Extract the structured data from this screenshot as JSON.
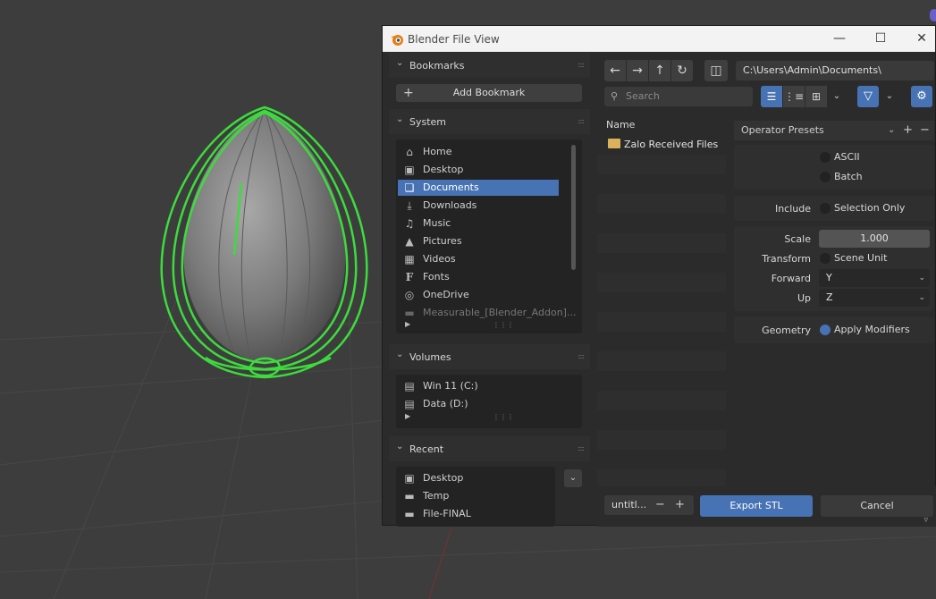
{
  "window": {
    "title": "Blender File View"
  },
  "sidebar": {
    "bookmarks": {
      "label": "Bookmarks",
      "add_label": "Add Bookmark"
    },
    "system": {
      "label": "System",
      "items": [
        {
          "label": "Home",
          "icon": "home-icon"
        },
        {
          "label": "Desktop",
          "icon": "desktop-icon"
        },
        {
          "label": "Documents",
          "icon": "documents-icon",
          "selected": true
        },
        {
          "label": "Downloads",
          "icon": "download-icon"
        },
        {
          "label": "Music",
          "icon": "music-icon"
        },
        {
          "label": "Pictures",
          "icon": "picture-icon"
        },
        {
          "label": "Videos",
          "icon": "video-icon"
        },
        {
          "label": "Fonts",
          "icon": "font-icon"
        },
        {
          "label": "OneDrive",
          "icon": "globe-icon"
        },
        {
          "label": "Measurable_[Blender_Addon]...",
          "icon": "folder-icon"
        }
      ]
    },
    "volumes": {
      "label": "Volumes",
      "items": [
        {
          "label": "Win 11 (C:)",
          "icon": "drive-icon"
        },
        {
          "label": "Data (D:)",
          "icon": "drive-icon"
        }
      ]
    },
    "recent": {
      "label": "Recent",
      "items": [
        {
          "label": "Desktop",
          "icon": "desktop-icon"
        },
        {
          "label": "Temp",
          "icon": "folder-icon"
        },
        {
          "label": "File-FINAL",
          "icon": "folder-icon"
        }
      ]
    }
  },
  "toolbar": {
    "path": "C:\\Users\\Admin\\Documents\\",
    "search_placeholder": "Search"
  },
  "filelist": {
    "header": "Name",
    "items": [
      {
        "label": "Zalo Received Files",
        "icon": "folder-icon"
      }
    ]
  },
  "properties": {
    "presets_label": "Operator Presets",
    "ascii_label": "ASCII",
    "batch_label": "Batch",
    "include_label": "Include",
    "selection_only_label": "Selection Only",
    "scale_label": "Scale",
    "scale_value": "1.000",
    "transform_label": "Transform",
    "scene_unit_label": "Scene Unit",
    "forward_label": "Forward",
    "forward_value": "Y",
    "up_label": "Up",
    "up_value": "Z",
    "geometry_label": "Geometry",
    "apply_modifiers_label": "Apply Modifiers",
    "apply_modifiers_checked": true
  },
  "bottom": {
    "filename": "untitl...",
    "export_label": "Export STL",
    "cancel_label": "Cancel"
  },
  "colors": {
    "accent": "#4772b3",
    "wire": "#3ddc3d"
  }
}
